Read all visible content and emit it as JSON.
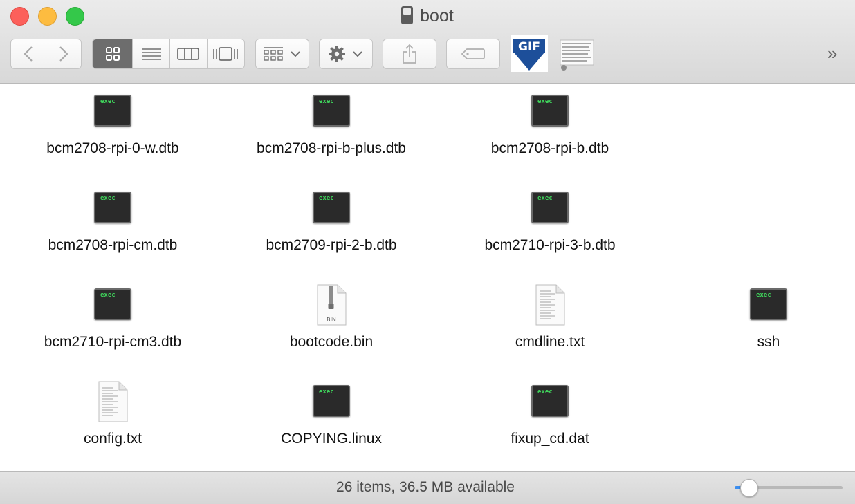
{
  "window": {
    "title": "boot"
  },
  "toolbar": {
    "back_icon": "chevron-left-icon",
    "forward_icon": "chevron-right-icon",
    "views": [
      "icon-view-icon",
      "list-view-icon",
      "column-view-icon",
      "coverflow-view-icon"
    ],
    "active_view": 0,
    "more_label": "»"
  },
  "files": [
    {
      "name": "bcm2708-rpi-0-w.dtb",
      "kind": "exec"
    },
    {
      "name": "bcm2708-rpi-b-plus.dtb",
      "kind": "exec"
    },
    {
      "name": "bcm2708-rpi-b.dtb",
      "kind": "exec"
    },
    {
      "name": "bcm2708-rpi-cm.dtb",
      "kind": "exec"
    },
    {
      "name": "bcm2709-rpi-2-b.dtb",
      "kind": "exec"
    },
    {
      "name": "bcm2710-rpi-3-b.dtb",
      "kind": "exec"
    },
    {
      "name": "bcm2710-rpi-cm3.dtb",
      "kind": "exec"
    },
    {
      "name": "bootcode.bin",
      "kind": "bin",
      "badge": "BIN"
    },
    {
      "name": "cmdline.txt",
      "kind": "text"
    },
    {
      "name": "ssh",
      "kind": "exec"
    },
    {
      "name": "config.txt",
      "kind": "text"
    },
    {
      "name": "COPYING.linux",
      "kind": "exec"
    },
    {
      "name": "fixup_cd.dat",
      "kind": "exec"
    }
  ],
  "exec_label": "exec",
  "status": {
    "text": "26 items, 36.5 MB available",
    "icon_size_fraction": 0.13
  },
  "colors": {
    "accent": "#3b8ef0",
    "exec_text": "#3fd35b"
  }
}
